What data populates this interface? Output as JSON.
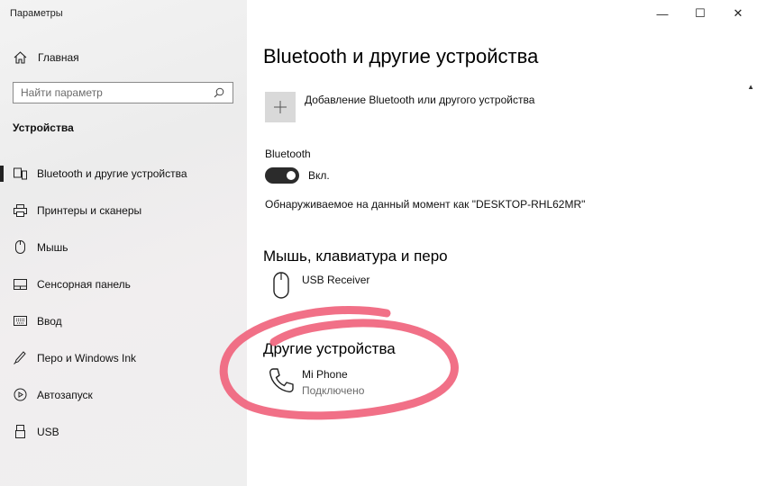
{
  "window": {
    "title": "Параметры",
    "controls": {
      "minimize": "—",
      "maximize": "☐",
      "close": "✕"
    }
  },
  "sidebar": {
    "home_label": "Главная",
    "search_placeholder": "Найти параметр",
    "section_title": "Устройства",
    "items": [
      {
        "label": "Bluetooth и другие устройства",
        "icon": "bluetooth-devices-icon",
        "selected": true
      },
      {
        "label": "Принтеры и сканеры",
        "icon": "printer-icon",
        "selected": false
      },
      {
        "label": "Мышь",
        "icon": "mouse-icon",
        "selected": false
      },
      {
        "label": "Сенсорная панель",
        "icon": "touchpad-icon",
        "selected": false
      },
      {
        "label": "Ввод",
        "icon": "keyboard-icon",
        "selected": false
      },
      {
        "label": "Перо и Windows Ink",
        "icon": "pen-icon",
        "selected": false
      },
      {
        "label": "Автозапуск",
        "icon": "autoplay-icon",
        "selected": false
      },
      {
        "label": "USB",
        "icon": "usb-icon",
        "selected": false
      }
    ]
  },
  "main": {
    "title": "Bluetooth и другие устройства",
    "add_device_label": "Добавление Bluetooth или другого устройства",
    "bluetooth": {
      "label": "Bluetooth",
      "toggle_state": "Вкл.",
      "discoverable_text": "Обнаруживаемое на данный момент как \"DESKTOP-RHL62MR\""
    },
    "mouse_section": {
      "title": "Мышь, клавиатура и перо",
      "devices": [
        {
          "name": "USB Receiver",
          "icon": "mouse-icon"
        }
      ]
    },
    "other_section": {
      "title": "Другие устройства",
      "devices": [
        {
          "name": "Mi Phone",
          "status": "Подключено",
          "icon": "phone-icon"
        }
      ]
    }
  },
  "colors": {
    "annotation": "#f0647d",
    "toggle_on": "#2b2b2b",
    "sidebar_bg": "#efefef"
  }
}
